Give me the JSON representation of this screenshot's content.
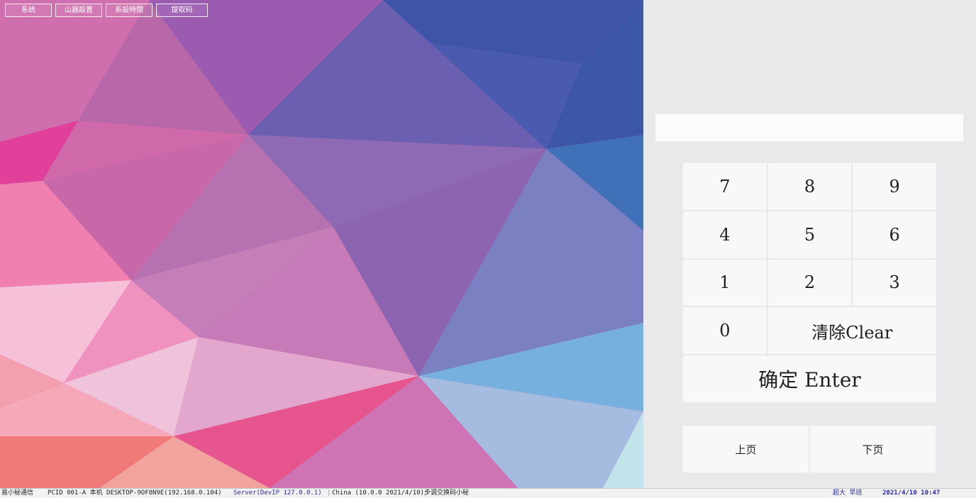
{
  "menu": [
    {
      "label": "系统"
    },
    {
      "label": "山器設置"
    },
    {
      "label": "系設時間"
    },
    {
      "label": "提取码"
    }
  ],
  "input": {
    "value": "",
    "placeholder": ""
  },
  "keypad": {
    "keys": [
      "7",
      "8",
      "9",
      "4",
      "5",
      "6",
      "1",
      "2",
      "3",
      "0"
    ],
    "clear_label": "清除Clear",
    "enter_label": "确定 Enter"
  },
  "pager": {
    "prev_label": "上页",
    "next_label": "下页"
  },
  "status": {
    "app_name": "易小秘通信",
    "pc_id": "PCID 001-A 本机 DESKTOP-9OF8N9E(192.168.0.104)",
    "server": "Server(DevIP 127.0.0.1)",
    "separator": "|",
    "china_info": "China (10.0.0 2021/4/10)步调交换码小秘",
    "user": "超大 早班",
    "datetime": "2021/4/10 10:47"
  },
  "colors": {
    "accent_blue": "#2a2aa8",
    "panel_bg": "#e9e8ea",
    "key_bg": "#f8f8f9"
  }
}
